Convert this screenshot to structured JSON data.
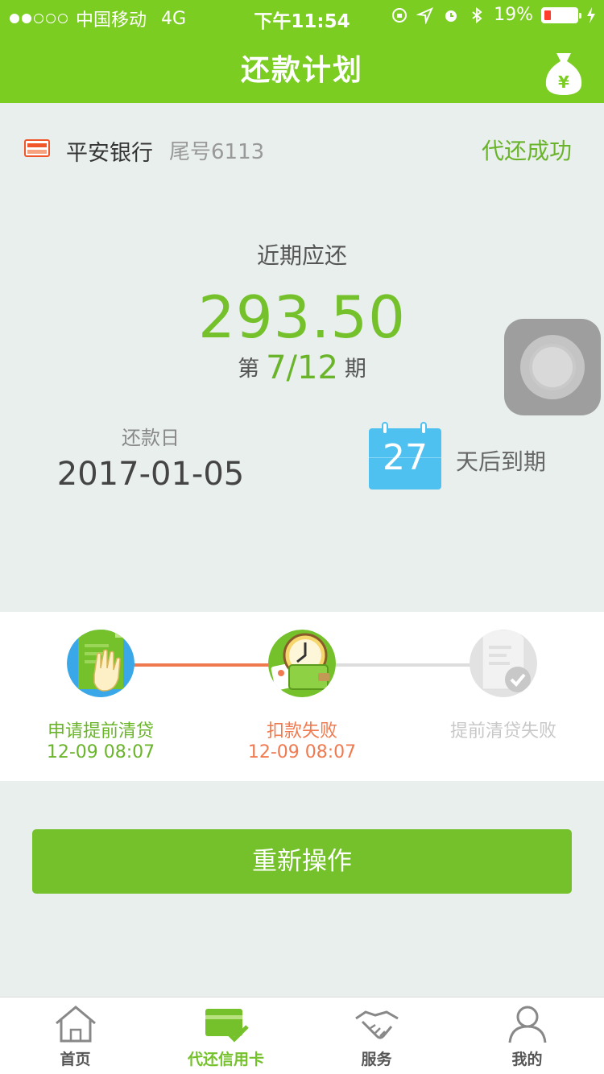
{
  "status_bar": {
    "carrier": "中国移动",
    "network": "4G",
    "time": "下午11:54",
    "battery": "19%"
  },
  "header": {
    "title": "还款计划"
  },
  "card": {
    "bank_name": "平安银行",
    "tail": "尾号6113",
    "status": "代还成功"
  },
  "due": {
    "label": "近期应还",
    "amount": "293.50",
    "period_prefix": "第",
    "period_value": "7/12",
    "period_suffix": "期"
  },
  "repay": {
    "label": "还款日",
    "date": "2017-01-05",
    "days_left": "27",
    "days_text": "天后到期"
  },
  "progress": {
    "steps": [
      {
        "label": "申请提前清贷",
        "time": "12-09 08:07",
        "state": "done"
      },
      {
        "label": "扣款失败",
        "time": "12-09 08:07",
        "state": "failed"
      },
      {
        "label": "提前清贷失败",
        "time": "",
        "state": "pending"
      }
    ]
  },
  "action_button": "重新操作",
  "tabbar": {
    "items": [
      {
        "label": "首页",
        "icon": "home-icon"
      },
      {
        "label": "代还信用卡",
        "icon": "credit-card-check-icon"
      },
      {
        "label": "服务",
        "icon": "handshake-icon"
      },
      {
        "label": "我的",
        "icon": "person-icon"
      }
    ],
    "active_index": 1
  },
  "colors": {
    "brand_green": "#7ccd22",
    "fail_orange": "#f07a4f",
    "calendar_blue": "#4fc1f1"
  }
}
